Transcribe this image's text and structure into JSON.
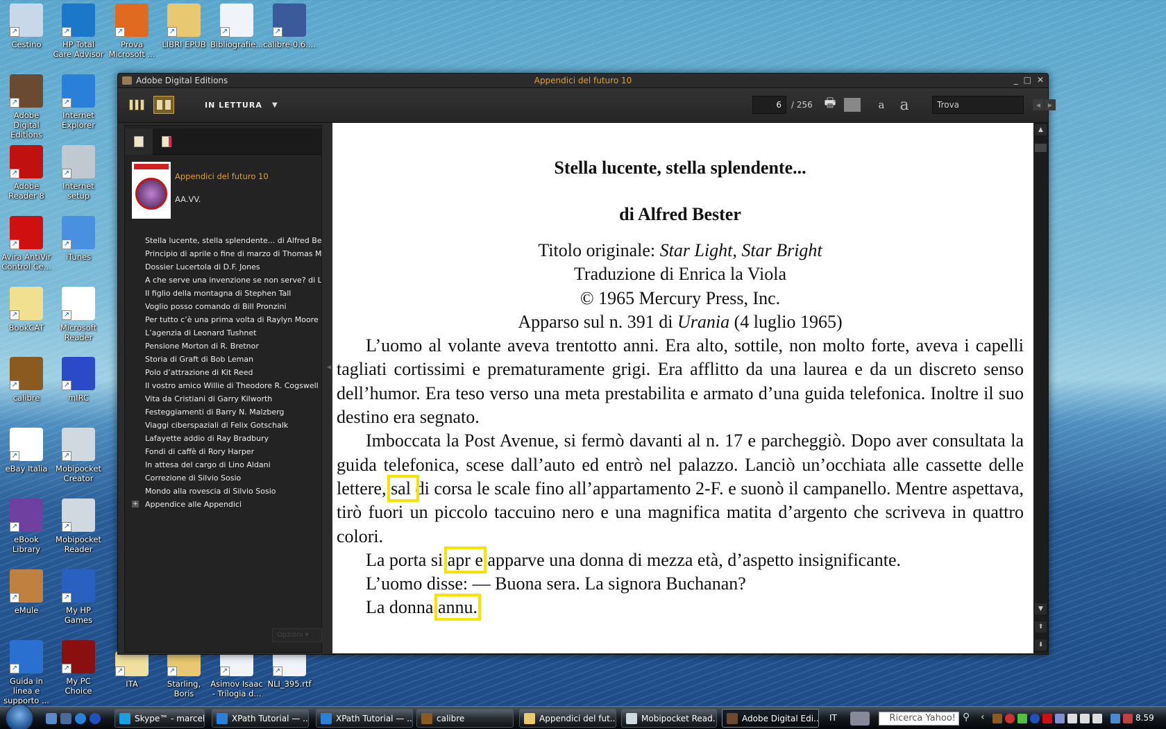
{
  "desktop": {
    "icons": [
      {
        "label": "Cestino",
        "color": "#c8d8e8"
      },
      {
        "label": "HP Total Care Advisor",
        "color": "#1b77c8"
      },
      {
        "label": "Prova Microsoft ...",
        "color": "#e06a20"
      },
      {
        "label": "LIBRI EPUB",
        "color": "#e8c870"
      },
      {
        "label": "Bibliografie...",
        "color": "#f0f4fa"
      },
      {
        "label": "calibre-0.6....",
        "color": "#3a5a9a"
      },
      {
        "label": "Adobe Digital Editions",
        "color": "#6a4a30"
      },
      {
        "label": "Internet Explorer",
        "color": "#2a80d8"
      },
      {
        "label": "Adobe Reader 8",
        "color": "#c01010"
      },
      {
        "label": "Internet setup",
        "color": "#c0c8d0"
      },
      {
        "label": "Avira AntiVir Control Ce...",
        "color": "#d01010"
      },
      {
        "label": "iTunes",
        "color": "#4a90e0"
      },
      {
        "label": "BookCAT",
        "color": "#f0e090"
      },
      {
        "label": "Microsoft Reader",
        "color": "#ffffff"
      },
      {
        "label": "calibre",
        "color": "#8a5a20"
      },
      {
        "label": "mIRC",
        "color": "#2a4ac8"
      },
      {
        "label": "eBay Italia",
        "color": "#ffffff"
      },
      {
        "label": "Mobipocket Creator",
        "color": "#d0d8e0"
      },
      {
        "label": "eBook Library",
        "color": "#7040a0"
      },
      {
        "label": "Mobipocket Reader",
        "color": "#d0d8e0"
      },
      {
        "label": "eMule",
        "color": "#c08040"
      },
      {
        "label": "My HP Games",
        "color": "#2a60c0"
      },
      {
        "label": "Guida in linea e supporto ...",
        "color": "#2a70d0"
      },
      {
        "label": "My PC Choice",
        "color": "#8a1010"
      },
      {
        "label": "ITA",
        "color": "#f0e0a0"
      },
      {
        "label": "Starling, Boris",
        "color": "#e8c870"
      },
      {
        "label": "Asimov Isaac - Trilogia d...",
        "color": "#f0f4fa"
      },
      {
        "label": "NLI_395.rtf",
        "color": "#f0f4fa"
      }
    ]
  },
  "window": {
    "app_title": "Adobe Digital Editions",
    "doc_title": "Appendici del futuro 10",
    "controls": {
      "minimize": "_",
      "maximize": "□",
      "close": "✕"
    },
    "accent": "#e0a030"
  },
  "toolbar": {
    "mode_label": "IN LETTURA",
    "page_current": "6",
    "page_total": "/ 256",
    "font_smaller": "a",
    "font_larger": "a",
    "search_placeholder": "Trova"
  },
  "sidebar": {
    "book_title": "Appendici del futuro 10",
    "book_author": "AA.VV.",
    "toc": [
      "Stella lucente, stella splendente... di Alfred Bester",
      "Principio di aprile o fine di marzo di Thomas M. Disch",
      "Dossier Lucertola di D.F. Jones",
      "A che serve una invenzione se non serve? di Leonard Tushnet",
      "Il figlio della montagna di Stephen Tall",
      "Voglio posso comando di Bill Pronzini",
      "Per tutto c’è una prima volta di Raylyn Moore",
      "L’agenzia di Leonard Tushnet",
      "Pensione Morton di R. Bretnor",
      "Storia di Graft di Bob Leman",
      "Polo d’attrazione di Kit Reed",
      "Il vostro amico Willie di Theodore R. Cogswell",
      "Vita da Cristiani di Garry Kilworth",
      "Festeggiamenti di Barry N. Malzberg",
      "Viaggi ciberspaziali di Felix Gotschalk",
      "Lafayette addio di Ray Bradbury",
      "Fondi di caffè di Rory Harper",
      "In attesa del cargo di Lino Aldani",
      "Correzione di Silvio Sosio",
      "Mondo alla rovescia di Silvio Sosio",
      "Appendice alle Appendici"
    ],
    "options_label": "Opzioni"
  },
  "page": {
    "title": "Stella lucente, stella splendente...",
    "author": "di Alfred Bester",
    "orig_prefix": "Titolo originale: ",
    "orig_title": "Star Light, Star Bright",
    "translation": "Traduzione di Enrica la Viola",
    "copyright": "© 1965 Mercury Press, Inc.",
    "appeared_prefix": "Apparso sul n. 391 di ",
    "appeared_mag": "Urania",
    "appeared_suffix": " (4 luglio 1965)",
    "p1": "L’uomo al volante aveva trentotto anni. Era alto, sottile, non molto forte, aveva i capelli tagliati cortissimi e prematuramente grigi. Era afflitto da una laurea e da un discreto senso dell’humor. Era teso verso una meta prestabilita e armato d’una guida telefonica. Inoltre il suo destino era segnato.",
    "p2a": "Imboccata la Post Avenue, si fermò davanti al n. 17 e parcheggiò. Dopo aver consultata la guida telefonica, scese dall’auto ed entrò nel palazzo. Lanciò un’occhiata alle cassette delle lettere, ",
    "p2hl": "sal ",
    "p2b": "di corsa le scale fino all’appartamento 2-F. e suonò il campanello. Mentre aspettava, tirò fuori un piccolo taccuino nero e una magnifica matita d’argento che scriveva in quattro colori.",
    "p3a": "La porta si ",
    "p3hl": "apr e",
    "p3b": " apparve una donna di mezza età, d’aspetto insignificante.",
    "p4": "L’uomo disse: — Buona sera. La signora Buchanan?",
    "p5a": "La donna ",
    "p5hl": "annu.",
    "highlight_color": "#f5e400"
  },
  "taskbar": {
    "tasks": [
      {
        "label": "Skype™ - marcelli...",
        "color": "#1aa0e0"
      },
      {
        "label": "XPath Tutorial — ...",
        "color": "#2a80d8"
      },
      {
        "label": "XPath Tutorial — ...",
        "color": "#2a80d8"
      },
      {
        "label": "calibre",
        "color": "#8a5a20"
      },
      {
        "label": "Appendici del fut...",
        "color": "#e8c870"
      },
      {
        "label": "Mobipocket Read...",
        "color": "#d0d8e0"
      },
      {
        "label": "Adobe Digital Edi...",
        "color": "#6a4a30"
      }
    ],
    "language": "IT",
    "search_placeholder": "Ricerca Yahoo!",
    "clock": "8.59"
  }
}
